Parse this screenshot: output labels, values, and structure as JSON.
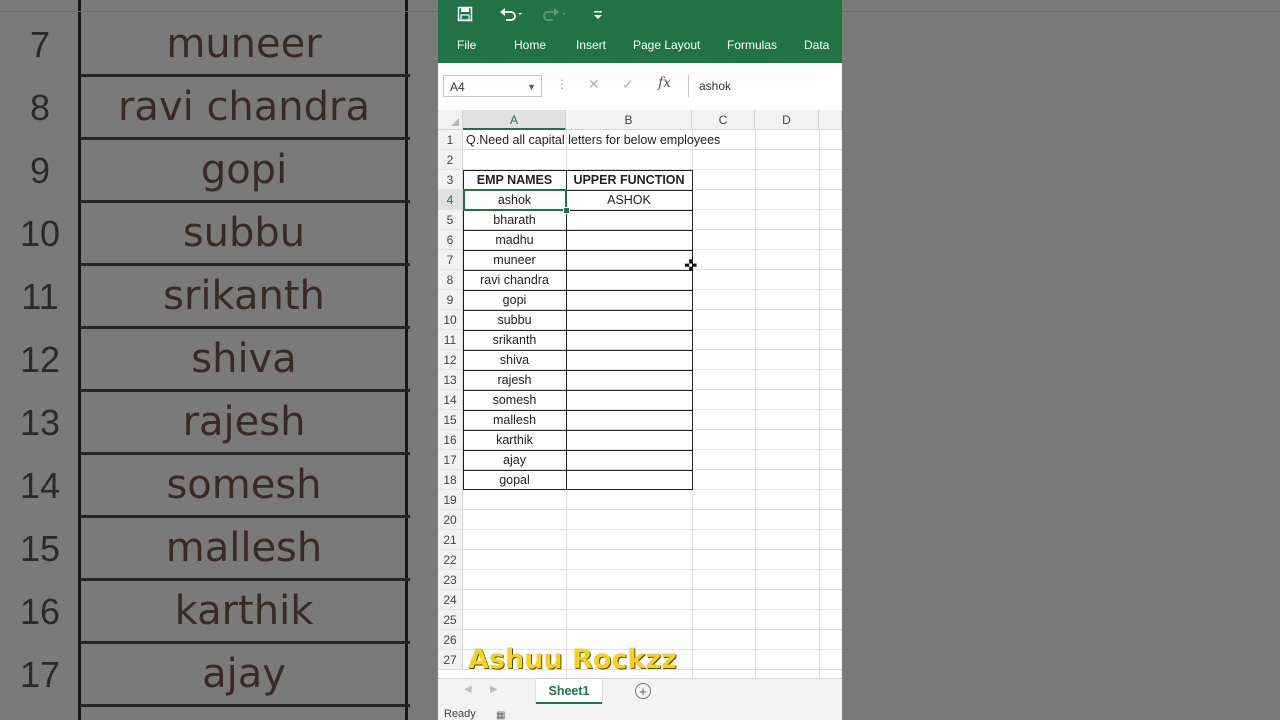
{
  "background": {
    "rows": [
      {
        "num": "7",
        "name": "muneer"
      },
      {
        "num": "8",
        "name": "ravi chandra"
      },
      {
        "num": "9",
        "name": "gopi"
      },
      {
        "num": "10",
        "name": "subbu"
      },
      {
        "num": "11",
        "name": "srikanth"
      },
      {
        "num": "12",
        "name": "shiva"
      },
      {
        "num": "13",
        "name": "rajesh"
      },
      {
        "num": "14",
        "name": "somesh"
      },
      {
        "num": "15",
        "name": "mallesh"
      },
      {
        "num": "16",
        "name": "karthik"
      },
      {
        "num": "17",
        "name": "ajay"
      }
    ]
  },
  "qat": {
    "save_icon": "save-icon",
    "undo_icon": "undo-icon",
    "redo_icon": "redo-icon",
    "customize_icon": "customize-qat-icon"
  },
  "ribbon": {
    "tabs": [
      "File",
      "Home",
      "Insert",
      "Page Layout",
      "Formulas",
      "Data"
    ],
    "color": "#217346"
  },
  "formula_bar": {
    "name_box": "A4",
    "fx_label": "fx",
    "content": "ashok"
  },
  "grid": {
    "columns": [
      "A",
      "B",
      "C",
      "D"
    ],
    "active_column": "A",
    "rows": [
      "1",
      "2",
      "3",
      "4",
      "5",
      "6",
      "7",
      "8",
      "9",
      "10",
      "11",
      "12",
      "13",
      "14",
      "15",
      "16",
      "17",
      "18",
      "19",
      "20",
      "21",
      "22",
      "23",
      "24",
      "25",
      "26",
      "27"
    ],
    "active_row": "4",
    "question": "Q.Need all capital letters for below employees",
    "header_a": "EMP NAMES",
    "header_b": "UPPER FUNCTION",
    "names": [
      "ashok",
      "bharath",
      "madhu",
      "muneer",
      "ravi chandra",
      "gopi",
      "subbu",
      "srikanth",
      "shiva",
      "rajesh",
      "somesh",
      "mallesh",
      "karthik",
      "ajay",
      "gopal"
    ],
    "upper": [
      "ASHOK"
    ]
  },
  "watermark": "Ashuu Rockzz",
  "sheets": {
    "active": "Sheet1",
    "add_icon": "add-sheet-icon"
  },
  "status": {
    "text": "Ready"
  }
}
